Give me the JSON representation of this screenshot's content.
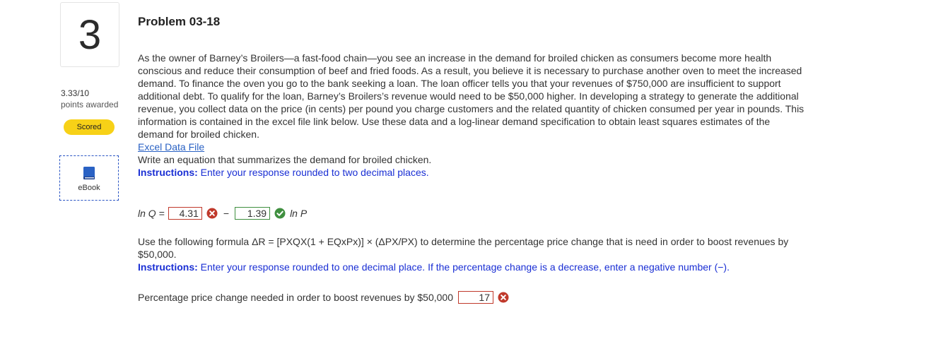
{
  "question": {
    "number": "3",
    "score": "3.33/10",
    "points_label": "points awarded",
    "status_badge": "Scored",
    "ebook_label": "eBook"
  },
  "problem": {
    "title": "Problem 03-18",
    "body": "As the owner of Barney’s Broilers—a fast-food chain—you see an increase in the demand for broiled chicken as consumers become more health conscious and reduce their consumption of beef and fried foods. As a result, you believe it is necessary to purchase another oven to meet the increased demand. To finance the oven you go to the bank seeking a loan. The loan officer tells you that your revenues of $750,000 are insufficient to support additional debt. To qualify for the loan, Barney’s Broilers’s revenue would need to be $50,000 higher. In developing a strategy to generate the additional revenue, you collect data on the price (in cents) per pound you charge customers and the related quantity of chicken consumed per year in pounds. This information is contained in the excel file link below. Use these data and a log-linear demand specification to obtain least squares estimates of the demand for broiled chicken.",
    "link_text": "Excel Data File",
    "prompt1": "Write an equation that summarizes the demand for broiled chicken.",
    "instr1_label": "Instructions:",
    "instr1_text": " Enter your response rounded to two decimal places."
  },
  "equation": {
    "lhs": "ln Q",
    "equals": "=",
    "intercept_value": "4.31",
    "intercept_status": "incorrect",
    "minus": "−",
    "slope_value": "1.39",
    "slope_status": "correct",
    "rhs": "ln P"
  },
  "part2": {
    "formula_text": "Use the following formula ΔR = [PXQX(1 + EQxPx)] × (ΔPX/PX) to determine the percentage price change that is need in order to boost revenues by $50,000.",
    "instr2_label": "Instructions:",
    "instr2_text": " Enter your response rounded to one decimal place. If the percentage change is a decrease, enter a negative number (−).",
    "pct_label": "Percentage price change needed in order to boost revenues by $50,000",
    "pct_value": "17",
    "pct_status": "incorrect"
  },
  "colors": {
    "incorrect": "#c0392b",
    "correct": "#3f8f3f",
    "instructions": "#1a2fd4",
    "badge": "#f7d117",
    "link": "#2a62c4"
  },
  "icons": {
    "incorrect": "x-circle-icon",
    "correct": "check-circle-icon",
    "ebook": "book-icon"
  }
}
